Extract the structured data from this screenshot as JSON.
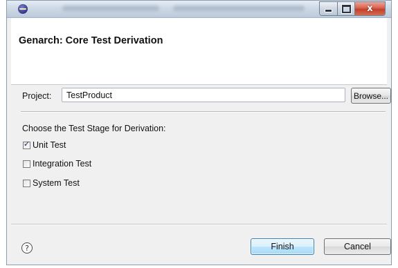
{
  "dialog": {
    "title": "Genarch: Core Test Derivation"
  },
  "caption": {
    "close_glyph": "x"
  },
  "project": {
    "label": "Project:",
    "value": "TestProduct",
    "browse_label": "Browse..."
  },
  "stage": {
    "heading": "Choose the Test  Stage for Derivation:",
    "options": [
      {
        "label": "Unit Test",
        "checked": true
      },
      {
        "label": "Integration Test",
        "checked": false
      },
      {
        "label": "System Test",
        "checked": false
      }
    ]
  },
  "footer": {
    "help_icon": "question-mark-circle",
    "help_glyph": "?",
    "finish_label": "Finish",
    "cancel_label": "Cancel"
  },
  "colors": {
    "dialog_bg": "#f0f0f0",
    "banner_bg": "#ffffff",
    "default_button_border": "#3c7fb1",
    "close_button": "#c2412b"
  }
}
